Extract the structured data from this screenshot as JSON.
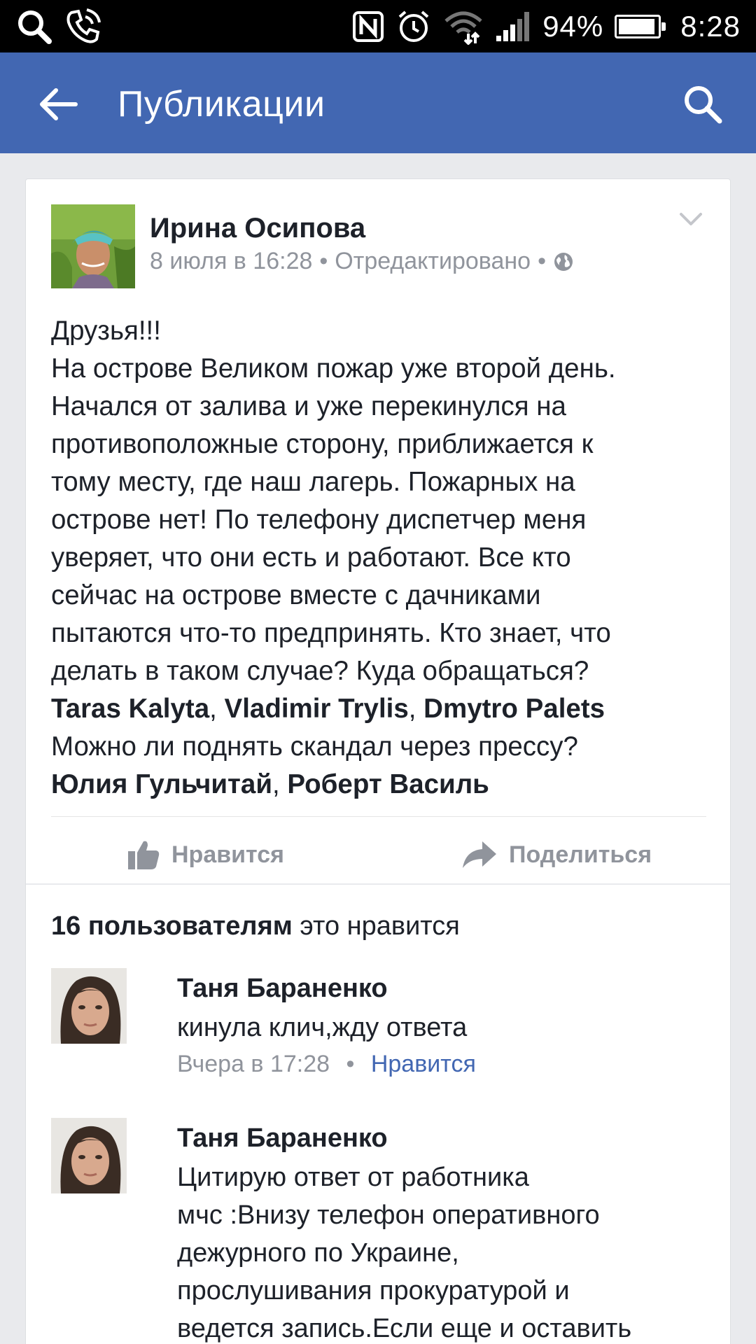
{
  "status_bar": {
    "battery_text": "94%",
    "battery_level": 0.94,
    "time": "8:28",
    "icons": [
      "search-icon",
      "phone-wifi-icon",
      "nfc-icon",
      "alarm-icon",
      "wifi-icon",
      "signal-icon",
      "battery-icon"
    ]
  },
  "app_bar": {
    "title": "Публикации",
    "icons": [
      "back-arrow-icon",
      "search-icon"
    ],
    "color": "#4267b2"
  },
  "post": {
    "author": "Ирина Осипова",
    "date": "8 июля в 16:28",
    "separator": "•",
    "edited": "Отредактировано",
    "separator2": "•",
    "privacy_icon": "globe-icon",
    "menu_icon": "chevron-down-icon",
    "lines": [
      "Друзья!!!",
      "На острове Великом пожар уже второй день.",
      "Начался от залива и уже перекинулся на",
      "противоположные сторону, приближается к",
      "тому месту, где наш лагерь. Пожарных на",
      "острове нет! По телефону диспетчер меня",
      "уверяет, что они есть и работают. Все кто",
      "сейчас на острове вместе с дачниками",
      "пытаются что-то предпринять. Кто знает, что",
      "делать в таком случае? Куда обращаться?"
    ],
    "tags1": [
      "Taras Kalyta",
      "Vladimir Trylis",
      "Dmytro Palets"
    ],
    "tag_sep": ", ",
    "line_after_tags": "Можно ли поднять скандал через прессу?",
    "tags2": [
      "Юлия Гульчитай",
      "Роберт Василь"
    ]
  },
  "actions": {
    "like_label": "Нравится",
    "share_label": "Поделиться"
  },
  "likes_summary": {
    "count_text": "16 пользователям",
    "rest_text": " это нравится"
  },
  "comments": [
    {
      "author": "Таня Бараненко",
      "lines": [
        "кинула клич,жду ответа"
      ],
      "time": "Вчера в 17:28",
      "dot": "•",
      "like_label": "Нравится"
    },
    {
      "author": "Таня Бараненко",
      "lines": [
        "Цитирую ответ от работника",
        "мчс :Внизу телефон оперативного",
        "дежурного по Украине,",
        "прослушивания прокуратурой и",
        "ведется запись.Если еще и оставить"
      ]
    }
  ]
}
